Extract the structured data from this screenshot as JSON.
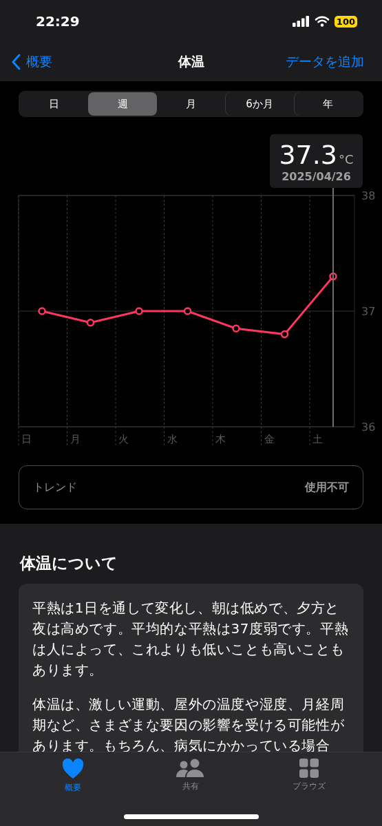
{
  "status_bar": {
    "time": "22:29",
    "battery": "100"
  },
  "nav": {
    "back": "概要",
    "title": "体温",
    "action": "データを追加"
  },
  "segments": [
    {
      "label": "日",
      "selected": false
    },
    {
      "label": "週",
      "selected": true
    },
    {
      "label": "月",
      "selected": false
    },
    {
      "label": "6か月",
      "selected": false
    },
    {
      "label": "年",
      "selected": false
    }
  ],
  "tooltip": {
    "value": "37.3",
    "unit": "°C",
    "date": "2025/04/26"
  },
  "chart_data": {
    "type": "line",
    "categories": [
      "日",
      "月",
      "火",
      "水",
      "木",
      "金",
      "土"
    ],
    "series": [
      {
        "color": "#ff375f",
        "marker": "circle",
        "values": [
          37.0,
          36.9,
          37.0,
          37.0,
          36.85,
          36.8,
          37.3
        ]
      }
    ],
    "ylim": [
      36,
      38
    ],
    "yticks": [
      36,
      37,
      38
    ]
  },
  "trend": {
    "label": "トレンド",
    "value": "使用不可"
  },
  "about": {
    "title": "体温について",
    "paragraphs": [
      "平熱は1日を通して変化し、朝は低めで、夕方と夜は高めです。平均的な平熱は37度弱です。平熱は人によって、これよりも低いことも高いこともあります。",
      "体温は、激しい運動、屋外の温度や湿度、月経周期など、さまざまな要因の影響を受ける可能性があります。もちろん、病気にかかっている場合"
    ]
  },
  "tab_bar": [
    {
      "label": "概要",
      "kind": "heart",
      "selected": true
    },
    {
      "label": "共有",
      "kind": "people",
      "selected": false
    },
    {
      "label": "ブラウズ",
      "kind": "grid",
      "selected": false
    }
  ]
}
